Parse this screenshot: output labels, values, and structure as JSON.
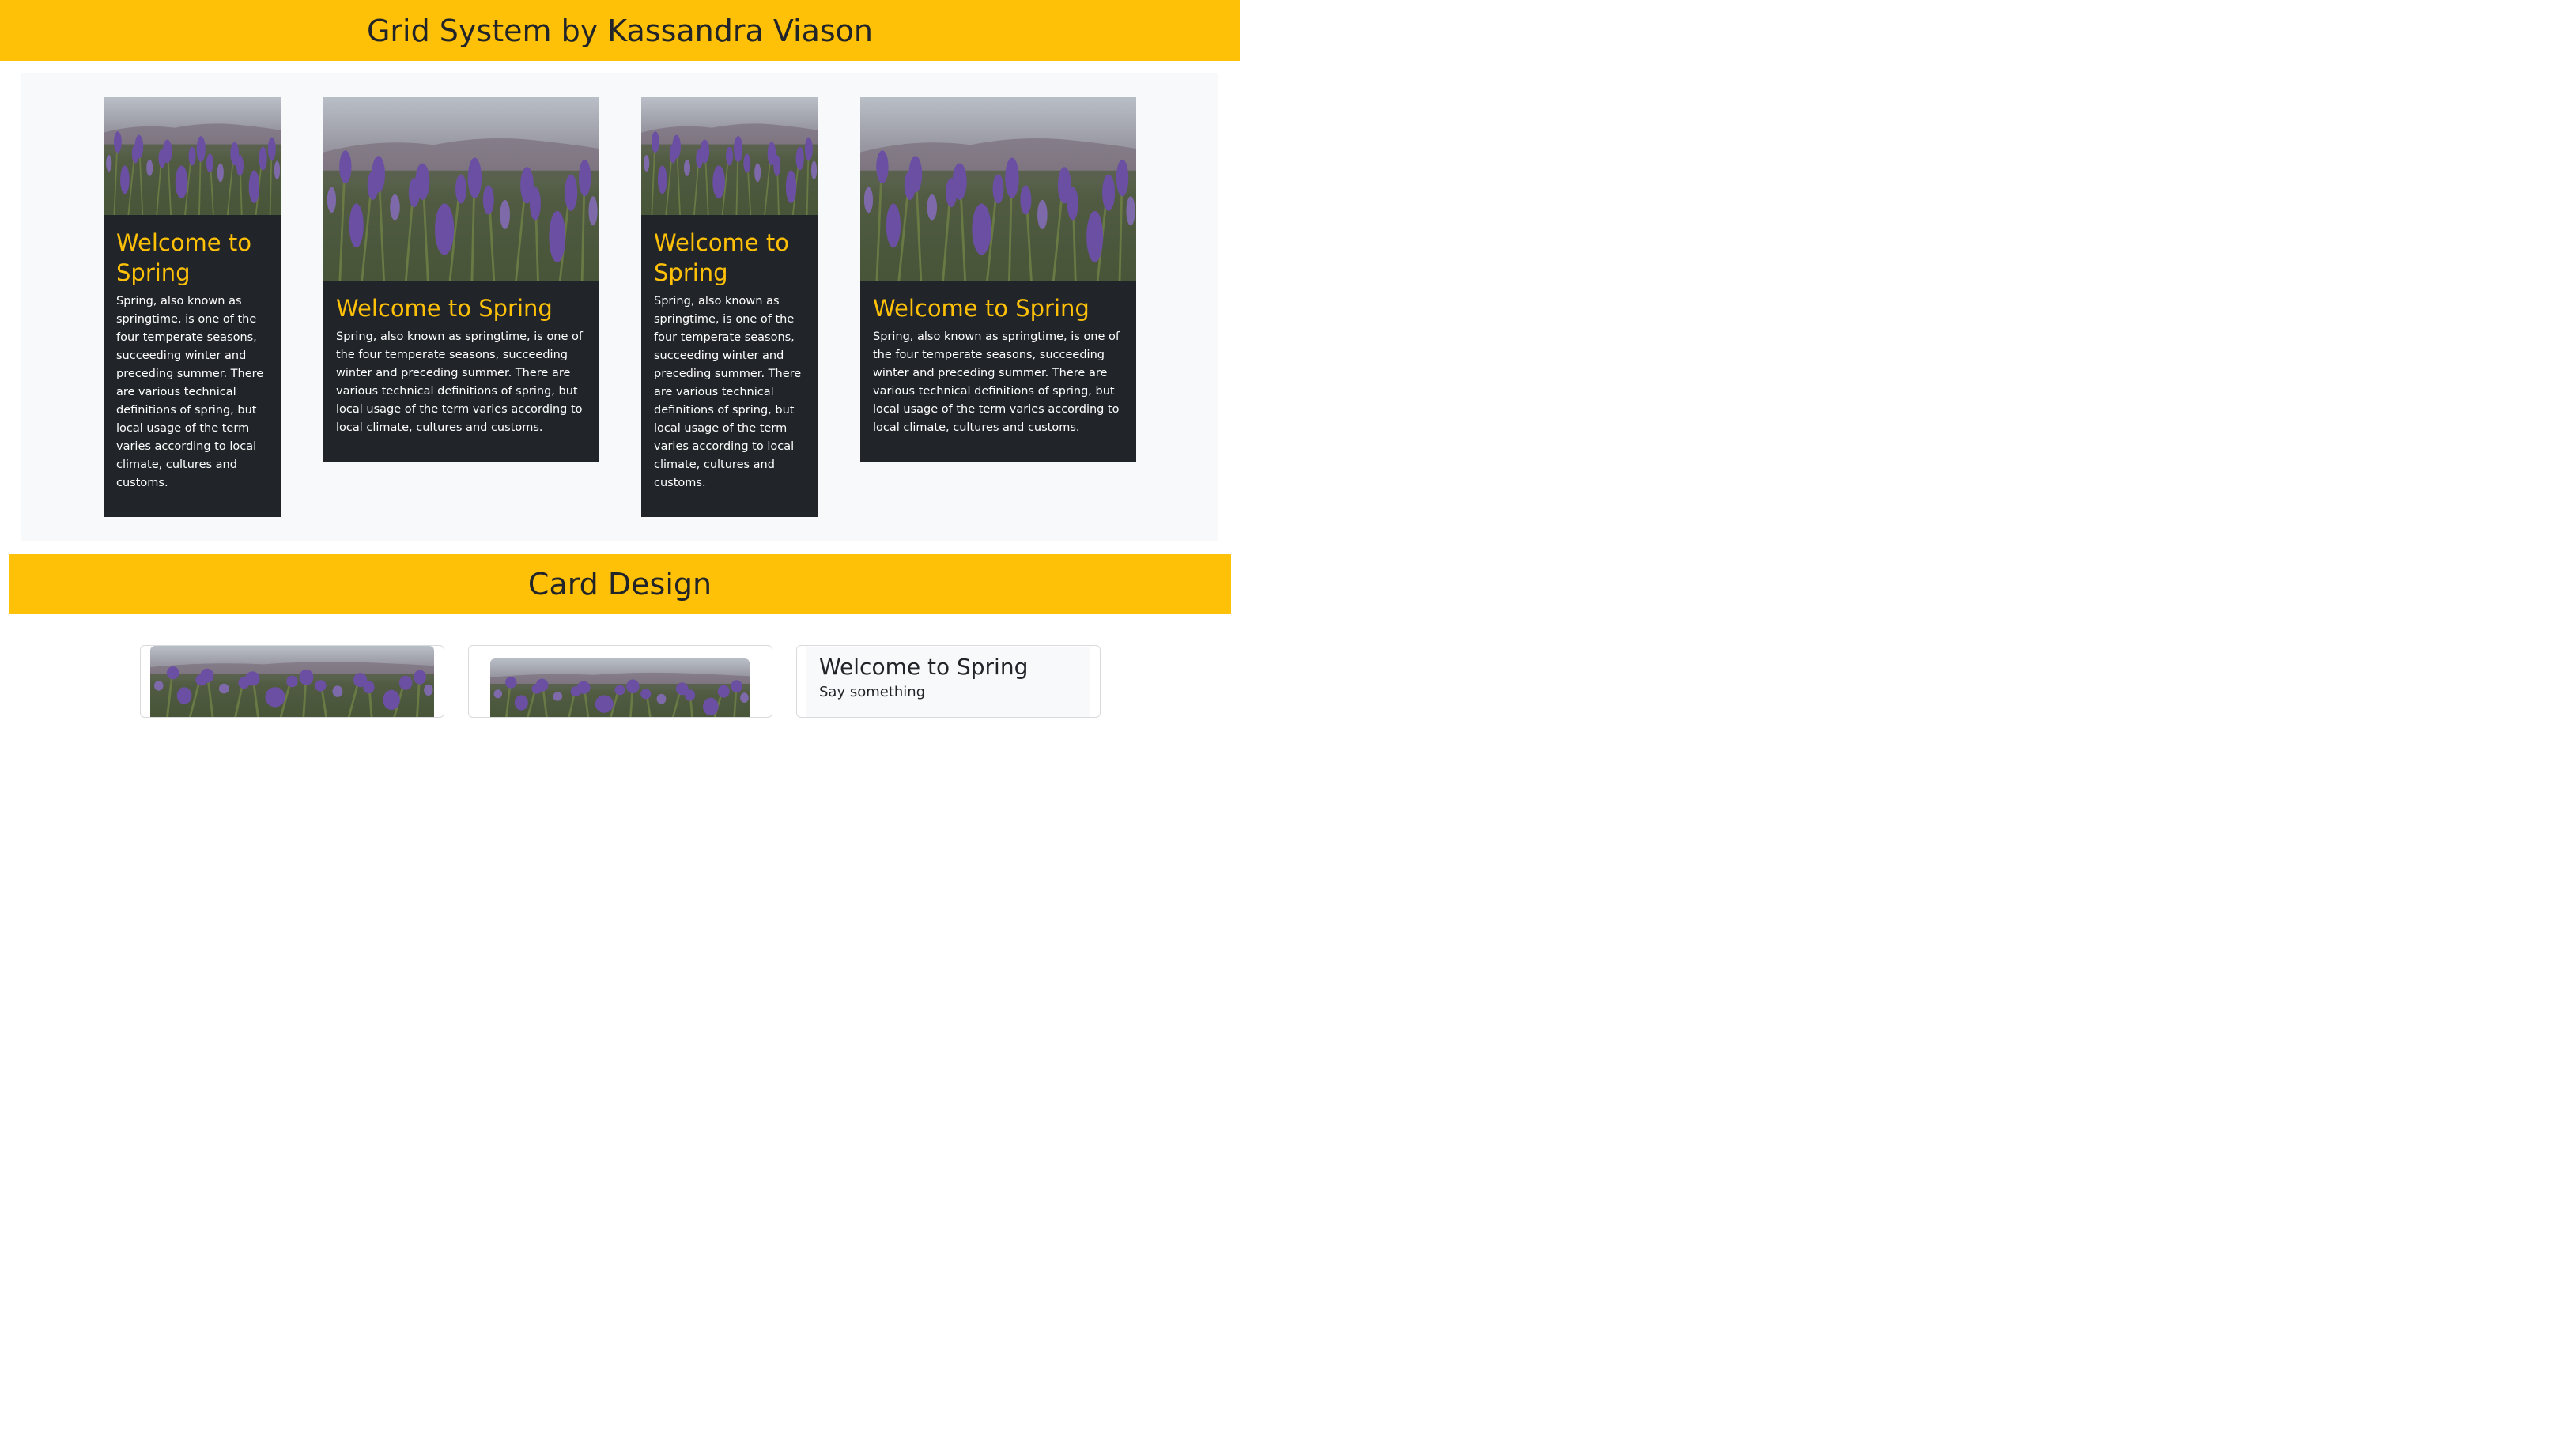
{
  "header": {
    "title": "Grid System by Kassandra Viason"
  },
  "grid_cards": [
    {
      "title": "Welcome to Spring",
      "text": "Spring, also known as springtime, is one of the four temperate seasons, succeeding winter and preceding summer. There are various technical definitions of spring, but local usage of the term varies according to local climate, cultures and customs."
    },
    {
      "title": "Welcome to Spring",
      "text": "Spring, also known as springtime, is one of the four temperate seasons, succeeding winter and preceding summer. There are various technical definitions of spring, but local usage of the term varies according to local climate, cultures and customs."
    },
    {
      "title": "Welcome to Spring",
      "text": "Spring, also known as springtime, is one of the four temperate seasons, succeeding winter and preceding summer. There are various technical definitions of spring, but local usage of the term varies according to local climate, cultures and customs."
    },
    {
      "title": "Welcome to Spring",
      "text": "Spring, also known as springtime, is one of the four temperate seasons, succeeding winter and preceding summer. There are various technical definitions of spring, but local usage of the term varies according to local climate, cultures and customs."
    }
  ],
  "card_section": {
    "title": "Card Design",
    "cards": [
      {
        "type": "image"
      },
      {
        "type": "image"
      },
      {
        "type": "text",
        "title": "Welcome to Spring",
        "subtitle": "Say something"
      }
    ]
  },
  "colors": {
    "accent": "#ffc107",
    "dark": "#212529",
    "light_bg": "#f8f9fa"
  }
}
